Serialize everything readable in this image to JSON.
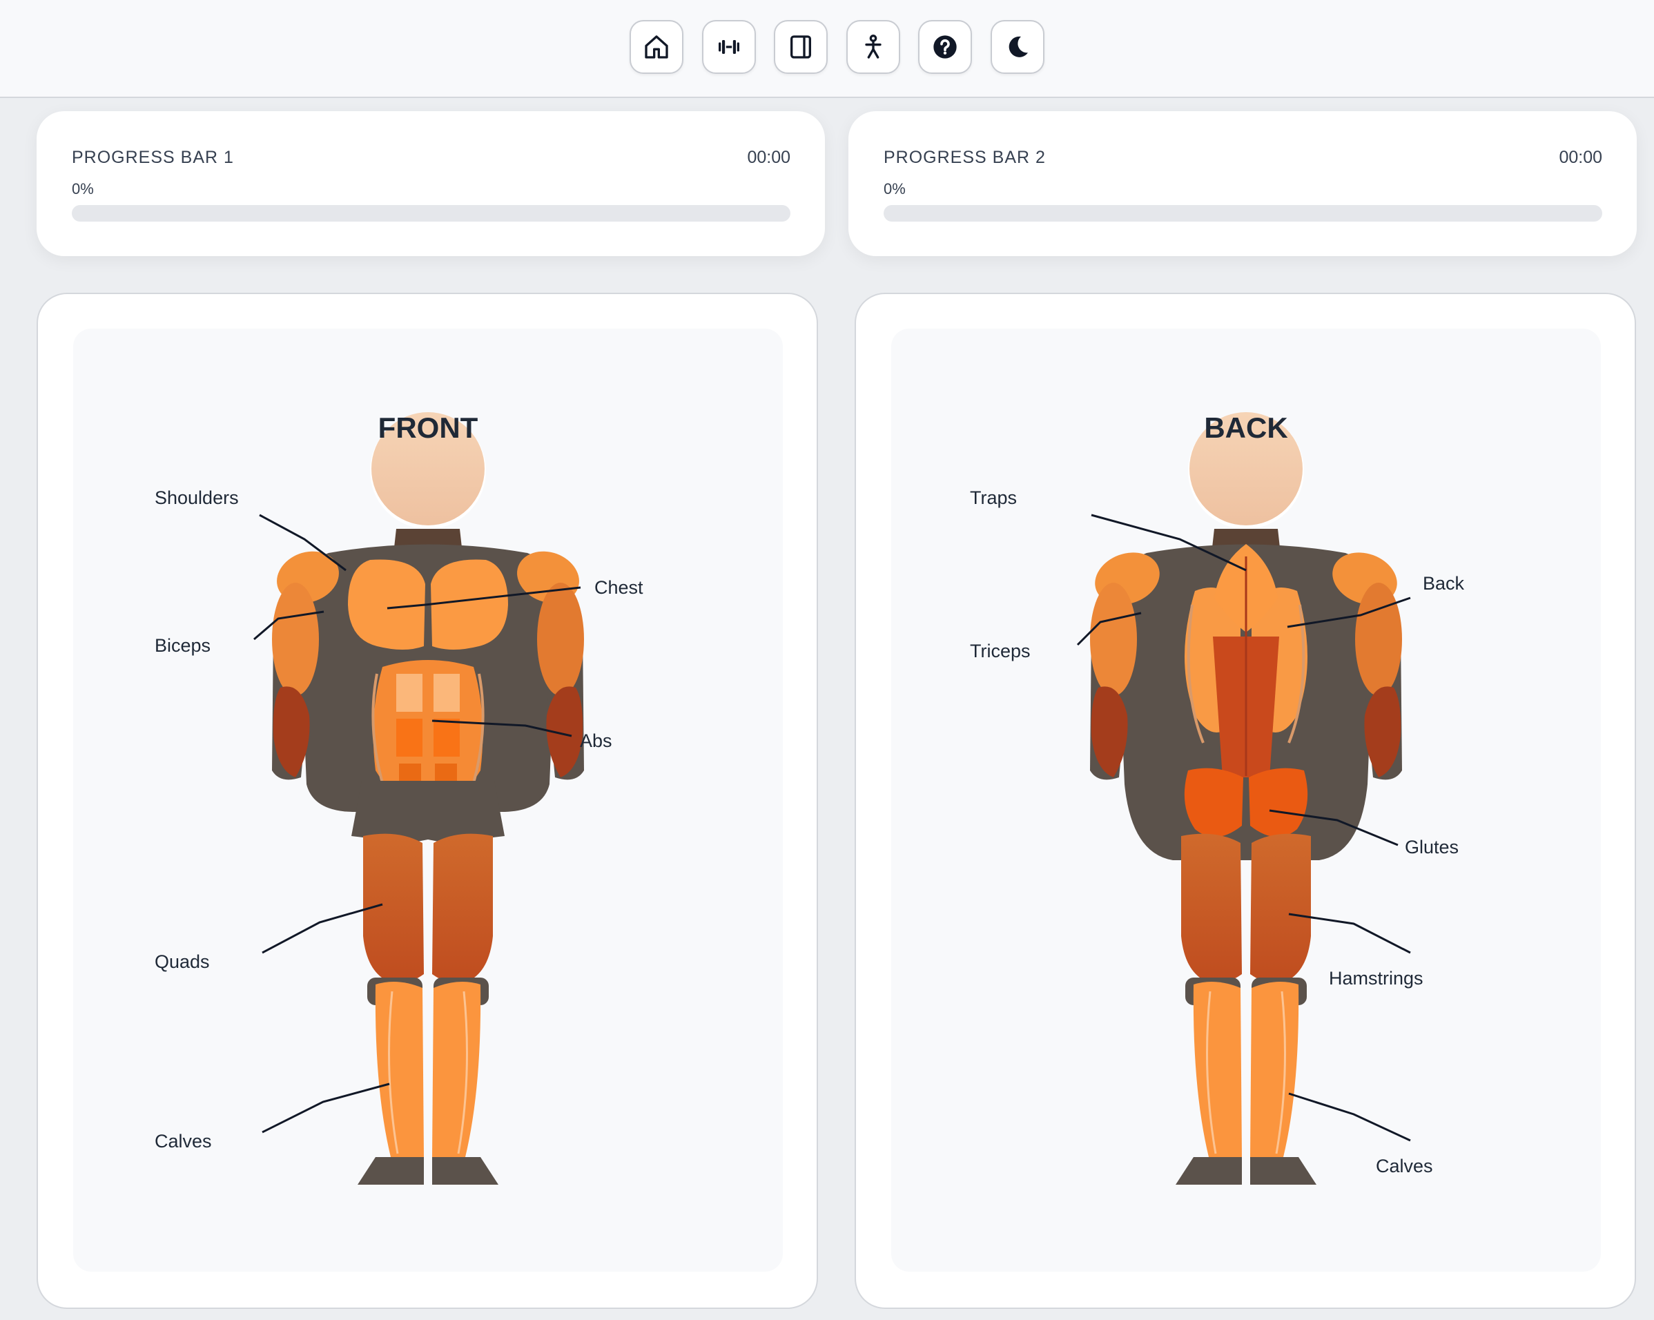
{
  "toolbar": {
    "buttons": [
      {
        "name": "home",
        "icon": "home-icon"
      },
      {
        "name": "workout",
        "icon": "dumbbell-icon"
      },
      {
        "name": "panel",
        "icon": "sidebar-panel-icon"
      },
      {
        "name": "body",
        "icon": "person-icon"
      },
      {
        "name": "help",
        "icon": "help-circle-icon"
      },
      {
        "name": "theme",
        "icon": "moon-icon"
      }
    ]
  },
  "progress": [
    {
      "label": "PROGRESS BAR 1",
      "time": "00:00",
      "percent_text": "0%",
      "value": 0
    },
    {
      "label": "PROGRESS BAR 2",
      "time": "00:00",
      "percent_text": "0%",
      "value": 0
    }
  ],
  "front": {
    "title": "FRONT",
    "labels": {
      "shoulders": "Shoulders",
      "chest": "Chest",
      "biceps": "Biceps",
      "abs": "Abs",
      "quads": "Quads",
      "calves": "Calves"
    }
  },
  "back": {
    "title": "BACK",
    "labels": {
      "traps": "Traps",
      "back": "Back",
      "triceps": "Triceps",
      "glutes": "Glutes",
      "hamstrings": "Hamstrings",
      "calves": "Calves"
    }
  },
  "colors": {
    "accent": "#f97316",
    "body_dark": "#5b524b",
    "muscle_light": "#fb9a43",
    "muscle_mid": "#e07a30",
    "muscle_deep": "#c0461e",
    "skin": "#f4cdaa"
  }
}
